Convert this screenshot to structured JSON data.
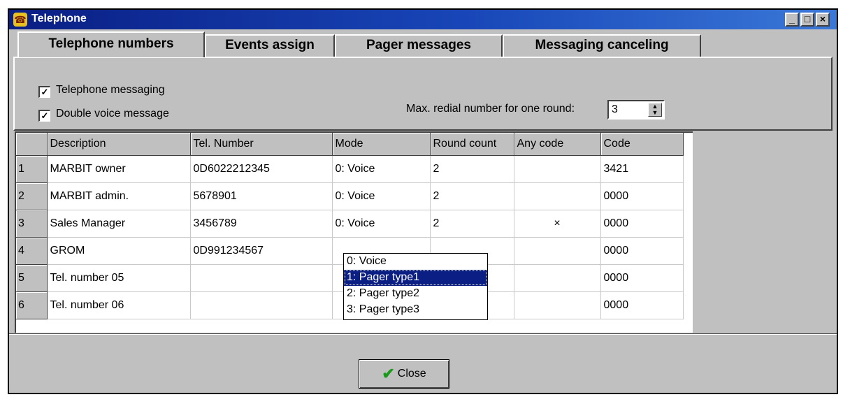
{
  "window": {
    "title": "Telephone",
    "title_icon": "telephone-icon",
    "minimize": "_",
    "maximize": "□",
    "close": "×"
  },
  "tabs": [
    {
      "label": "Telephone numbers",
      "active": true
    },
    {
      "label": "Events assign",
      "active": false
    },
    {
      "label": "Pager messages",
      "active": false
    },
    {
      "label": "Messaging canceling",
      "active": false
    }
  ],
  "options": {
    "telephone_messaging": {
      "label": "Telephone messaging",
      "checked": true
    },
    "double_voice_message": {
      "label": "Double voice message",
      "checked": true
    },
    "max_redial_label": "Max. redial number for one round:",
    "max_redial_value": "3"
  },
  "grid": {
    "headers": [
      "Description",
      "Tel. Number",
      "Mode",
      "Round count",
      "Any code",
      "Code"
    ],
    "rows": [
      {
        "num": "1",
        "description": "MARBIT owner",
        "tel": "0D6022212345",
        "mode": "0: Voice",
        "rounds": "2",
        "any_code": "",
        "code": "3421"
      },
      {
        "num": "2",
        "description": "MARBIT admin.",
        "tel": "5678901",
        "mode": "0: Voice",
        "rounds": "2",
        "any_code": "",
        "code": "0000"
      },
      {
        "num": "3",
        "description": "Sales Manager",
        "tel": "3456789",
        "mode": "0: Voice",
        "rounds": "2",
        "any_code": "×",
        "code": "0000"
      },
      {
        "num": "4",
        "description": "GROM",
        "tel": "0D991234567",
        "mode": "",
        "rounds": "",
        "any_code": "",
        "code": "0000"
      },
      {
        "num": "5",
        "description": "Tel. number 05",
        "tel": "",
        "mode": "",
        "rounds": "",
        "any_code": "",
        "code": "0000"
      },
      {
        "num": "6",
        "description": "Tel. number 06",
        "tel": "",
        "mode": "",
        "rounds": "",
        "any_code": "",
        "code": "0000"
      }
    ]
  },
  "mode_dropdown": {
    "options": [
      "0: Voice",
      "1: Pager type1",
      "2: Pager type2",
      "3: Pager type3"
    ],
    "selected": "1: Pager type1"
  },
  "close_button": {
    "label": "Close",
    "icon": "checkmark-icon"
  },
  "colors": {
    "titlebar": "#0a1e84",
    "face": "#c0c0c0",
    "selection": "#0a1e84"
  }
}
